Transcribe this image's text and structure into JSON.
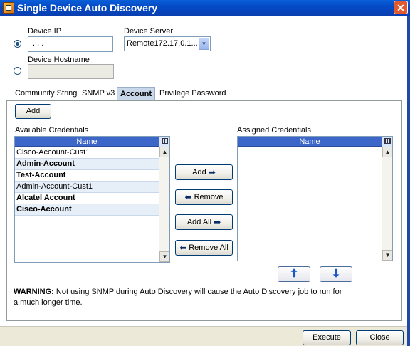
{
  "window": {
    "title": "Single Device Auto Discovery",
    "close_glyph": "✕"
  },
  "form": {
    "device_ip_label": "Device IP",
    "device_ip_value": ".   .   .",
    "device_server_label": "Device Server",
    "device_server_value": "Remote172.17.0.1...",
    "device_hostname_label": "Device Hostname",
    "device_hostname_value": ""
  },
  "tabs": [
    {
      "label": "Community String",
      "active": false
    },
    {
      "label": "SNMP v3",
      "active": false
    },
    {
      "label": "Account",
      "active": true
    },
    {
      "label": "Privilege Password",
      "active": false
    }
  ],
  "account_tab": {
    "add_label": "Add",
    "available_label": "Available Credentials",
    "assigned_label": "Assigned Credentials",
    "name_column": "Name",
    "available_items": [
      {
        "name": "Cisco-Account-Cust1",
        "bold": false,
        "shaded": false
      },
      {
        "name": "Admin-Account",
        "bold": true,
        "shaded": true
      },
      {
        "name": "Test-Account",
        "bold": true,
        "shaded": false
      },
      {
        "name": "Admin-Account-Cust1",
        "bold": false,
        "shaded": true
      },
      {
        "name": "Alcatel Account",
        "bold": true,
        "shaded": false
      },
      {
        "name": "Cisco-Account",
        "bold": true,
        "shaded": true
      }
    ],
    "assigned_items": [],
    "buttons": {
      "add": "Add",
      "remove": "Remove",
      "add_all": "Add All",
      "remove_all": "Remove All"
    }
  },
  "warning": {
    "prefix": "WARNING:",
    "text": "Not using SNMP during Auto Discovery will cause the Auto Discovery job to run for a much longer time."
  },
  "footer": {
    "execute_label": "Execute",
    "close_label": "Close"
  },
  "icons": {
    "arrow_right": "➡",
    "arrow_left": "⬅",
    "up": "⬆",
    "down": "⬇",
    "scroll_up": "▲",
    "scroll_down": "▼",
    "dropdown": "▼"
  },
  "colors": {
    "titlebar": "#0449c4",
    "column_header": "#3c67c8",
    "row_shade": "#e6eef8"
  }
}
